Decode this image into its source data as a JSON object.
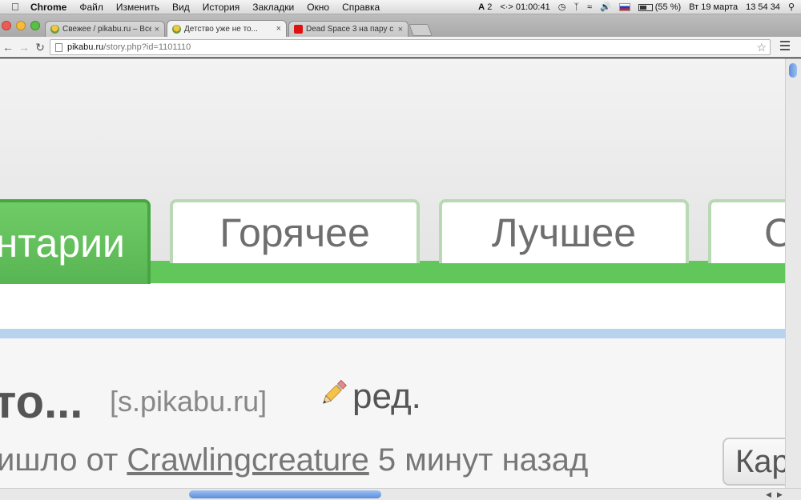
{
  "menubar": {
    "app": "Chrome",
    "items": [
      "Файл",
      "Изменить",
      "Вид",
      "История",
      "Закладки",
      "Окно",
      "Справка"
    ],
    "status": {
      "adobe": "2",
      "timer": "01:00:41",
      "battery": "(55 %)",
      "date": "Вт 19 марта",
      "time": "13 54 34"
    }
  },
  "tabs": [
    {
      "title": "Свежее / pikabu.ru – Все",
      "icon": "pikabu-favicon",
      "active": false
    },
    {
      "title": "Детство уже не то...",
      "icon": "pikabu-favicon",
      "active": true
    },
    {
      "title": "Dead Space 3 на пару с А",
      "icon": "youtube-favicon",
      "active": false
    }
  ],
  "toolbar": {
    "url_host": "pikabu.ru",
    "url_path": "/story.php?id=1101110"
  },
  "page": {
    "nav_tabs": [
      "нтарии",
      "Горячее",
      "Лучшее",
      "С"
    ],
    "story": {
      "title_fragment": "то...",
      "source": "[s.pikabu.ru]",
      "edit_label": "ред.",
      "meta_prefix": "ишло от ",
      "author": "Crawlingcreature",
      "meta_suffix": " 5 минут назад"
    },
    "side_button": "Кар"
  },
  "colors": {
    "green": "#62c75a",
    "blue_line": "#b7d3ee"
  }
}
